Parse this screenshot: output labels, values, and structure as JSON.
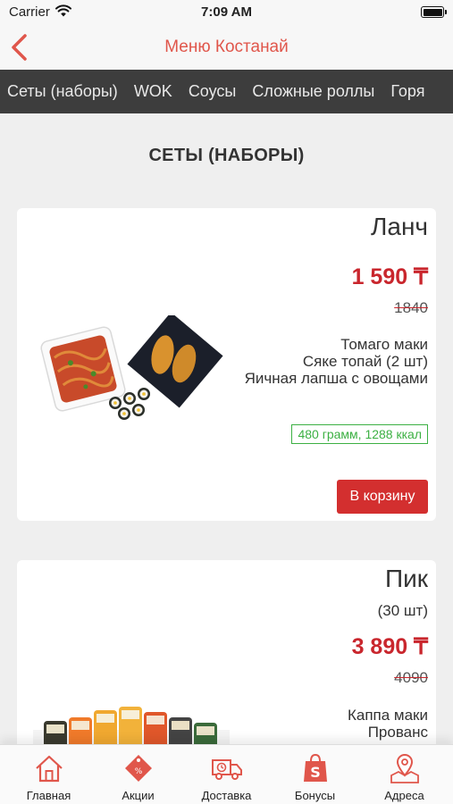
{
  "status_bar": {
    "carrier": "Carrier",
    "time": "7:09 AM"
  },
  "nav": {
    "title": "Меню Костанай"
  },
  "categories": [
    "Сеты (наборы)",
    "WOK",
    "Соусы",
    "Сложные роллы",
    "Горя"
  ],
  "section_title": "СЕТЫ (НАБОРЫ)",
  "products": [
    {
      "name": "Ланч",
      "price": "1 590 ₸",
      "old_price": "1840",
      "ingredients": [
        "Томаго маки",
        "Сяке топай (2 шт)",
        "Яичная лапша с овощами"
      ],
      "nutrition": "480 грамм, 1288 ккал",
      "cart_label": "В корзину"
    },
    {
      "name": "Пик",
      "quantity": "(30 шт)",
      "price": "3 890 ₸",
      "old_price": "4090",
      "ingredients": [
        "Каппа маки",
        "Прованс"
      ]
    }
  ],
  "tabs": [
    {
      "label": "Главная",
      "icon": "home-icon"
    },
    {
      "label": "Акции",
      "icon": "discount-tag-icon"
    },
    {
      "label": "Доставка",
      "icon": "delivery-truck-icon"
    },
    {
      "label": "Бонусы",
      "icon": "shopping-bag-icon"
    },
    {
      "label": "Адреса",
      "icon": "map-pin-icon"
    }
  ],
  "colors": {
    "accent": "#d32f2f",
    "title_red": "#e0564b",
    "price_red": "#c9262d",
    "nutrition_green": "#3cb043",
    "category_bar": "#3d3d3d"
  }
}
